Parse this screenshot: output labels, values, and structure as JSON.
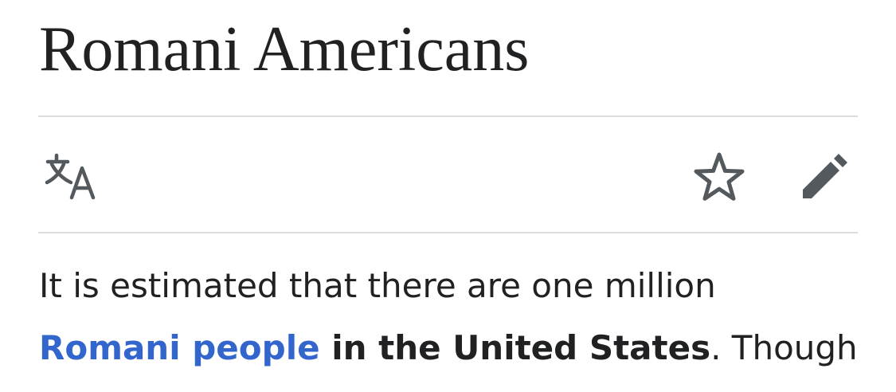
{
  "article": {
    "title": "Romani Americans",
    "body": {
      "line1": "It is estimated that there are one million",
      "link_text": "Romani people",
      "bold_text": " in the United States",
      "trailing_text": ". Though"
    }
  },
  "toolbar": {
    "language_icon": "translate-icon",
    "watch_icon": "star-outline-icon",
    "edit_icon": "pencil-icon"
  },
  "colors": {
    "link": "#3366cc",
    "text": "#202122",
    "icon": "#54595d",
    "divider": "#dcdcdc"
  }
}
